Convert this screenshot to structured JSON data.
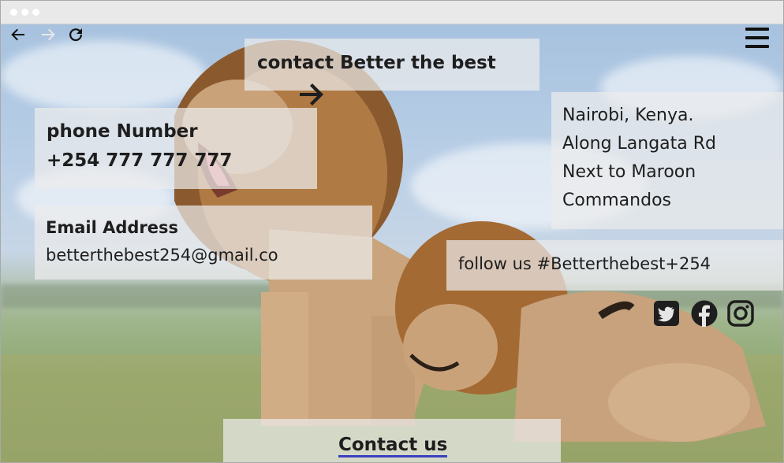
{
  "browser": {
    "icons": [
      "arrow-left-icon",
      "arrow-right-icon",
      "reload-icon",
      "hamburger-menu-icon"
    ]
  },
  "header": {
    "title": "contact Better the best"
  },
  "contact": {
    "phone_label": "phone Number",
    "phone_value": "+254 777 777 777",
    "email_label": "Email Address",
    "email_value": "betterthebest254@gmail.co"
  },
  "address": {
    "lines": [
      "Nairobi, Kenya.",
      "Along Langata Rd",
      "Next to Maroon",
      "Commandos"
    ]
  },
  "social": {
    "label": "follow us #Betterthebest+254",
    "icons": [
      "twitter-icon",
      "facebook-icon",
      "instagram-icon"
    ]
  },
  "footer": {
    "contact_link": "Contact us"
  },
  "colors": {
    "panel": "#ebebeb",
    "text": "#1e1e1e",
    "link_underline": "#3b3fbf"
  }
}
